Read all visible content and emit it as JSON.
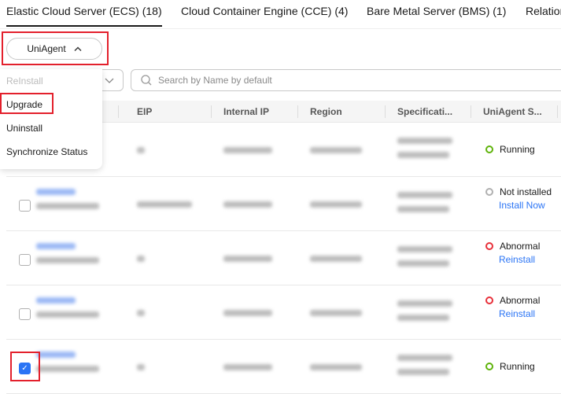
{
  "tabs": [
    {
      "label": "Elastic Cloud Server (ECS) (18)",
      "active": true
    },
    {
      "label": "Cloud Container Engine (CCE) (4)"
    },
    {
      "label": "Bare Metal Server (BMS) (1)"
    },
    {
      "label": "Relation"
    }
  ],
  "toolbar": {
    "uniagent_label": "UniAgent",
    "search_placeholder": "Search by Name by default"
  },
  "menu": {
    "items": [
      {
        "label": "ReInstall",
        "disabled": true
      },
      {
        "label": "Upgrade",
        "highlighted": true
      },
      {
        "label": "Uninstall"
      },
      {
        "label": "Synchronize Status"
      }
    ]
  },
  "table": {
    "columns": [
      "EIP",
      "Internal IP",
      "Region",
      "Specificati...",
      "UniAgent S..."
    ],
    "rows": [
      {
        "checked": false,
        "status": "Running",
        "status_color": "#5fb30a",
        "action": ""
      },
      {
        "checked": false,
        "status": "Not installed",
        "status_color": "#b0b0b0",
        "action": "Install Now"
      },
      {
        "checked": false,
        "status": "Abnormal",
        "status_color": "#e8303a",
        "action": "Reinstall"
      },
      {
        "checked": false,
        "status": "Abnormal",
        "status_color": "#e8303a",
        "action": "Reinstall"
      },
      {
        "checked": true,
        "status": "Running",
        "status_color": "#5fb30a",
        "action": ""
      }
    ]
  },
  "colors": {
    "accent": "#2a74f5",
    "highlight_box": "#e3202c"
  }
}
